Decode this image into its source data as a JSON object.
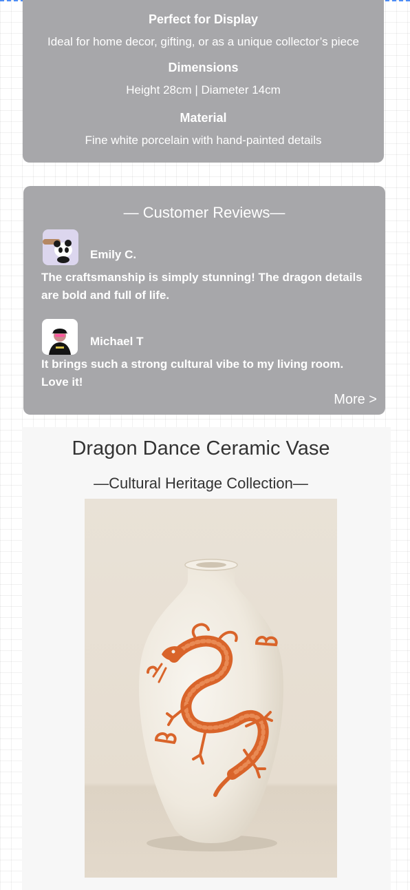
{
  "details": {
    "display_title": "Perfect for Display",
    "display_text": "Ideal for home decor, gifting, or as a unique collector’s piece",
    "dimensions_title": "Dimensions",
    "dimensions_text": "Height 28cm | Diameter 14cm",
    "material_title": "Material",
    "material_text": "Fine white porcelain with hand-painted details"
  },
  "reviews": {
    "title": "— Customer Reviews—",
    "items": [
      {
        "name": "Emily C.",
        "text": "The craftsmanship is simply stunning! The dragon details are bold and full of life.",
        "avatar_icon": "panda-avatar"
      },
      {
        "name": "Michael T",
        "text": "It brings such a strong cultural vibe to my living room. Love it!",
        "avatar_icon": "person-avatar"
      }
    ],
    "more_label": "More >"
  },
  "product": {
    "title": "Dragon Dance Ceramic Vase",
    "subtitle": "—Cultural Heritage Collection—",
    "image_icon": "dragon-vase-image"
  },
  "colors": {
    "card_bg": "#a7a7aa",
    "dragon": "#d9642a",
    "vase": "#f1ece3",
    "section_bg": "#f7f7f7"
  }
}
